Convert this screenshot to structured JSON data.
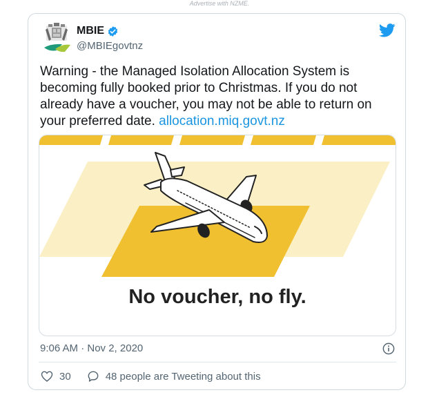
{
  "advert": "Advertise with NZME.",
  "tweet": {
    "name": "MBIE",
    "handle": "@MBIEgovtnz",
    "text": "Warning - the Managed Isolation Allocation System is becoming fully booked prior to Christmas. If you do not already have a voucher, you may not be able to return on your preferred date.",
    "link": "allocation.miq.govt.nz",
    "timestamp": "9:06 AM · Nov 2, 2020",
    "likes": "30",
    "conversation": "48 people are Tweeting about this"
  },
  "media": {
    "caption": "No voucher, no fly."
  },
  "icons": {
    "verified": "verified-badge-icon",
    "twitter": "twitter-bird-icon",
    "info": "info-icon",
    "like": "heart-icon",
    "reply": "speech-bubble-icon"
  },
  "colors": {
    "twitter_blue": "#1d9bf0",
    "link": "#1b95e0",
    "yellow": "#f0c030",
    "pale_yellow": "#fbefc5"
  }
}
